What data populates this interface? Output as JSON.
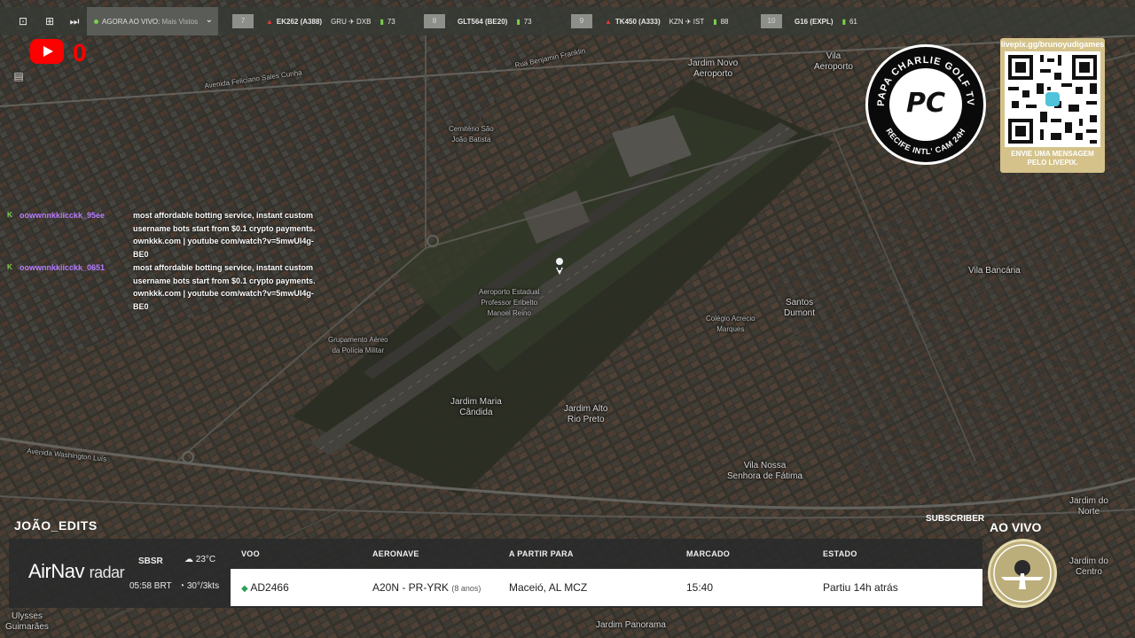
{
  "topbar": {
    "live_label": "AGORA AO VIVO:",
    "live_more": "Mais Vistos",
    "flights": [
      {
        "num": "7",
        "code": "EK262 (A388)",
        "route": "GRU ✈ DXB",
        "signal": "73",
        "alert": true
      },
      {
        "num": "8",
        "code": "GLT564 (BE20)",
        "route": "",
        "signal": "73",
        "alert": false
      },
      {
        "num": "9",
        "code": "TK450 (A333)",
        "route": "KZN ✈ IST",
        "signal": "88",
        "alert": true
      },
      {
        "num": "10",
        "code": "G16 (EXPL)",
        "route": "",
        "signal": "61",
        "alert": false
      }
    ]
  },
  "youtube": {
    "count": "0"
  },
  "chat": [
    {
      "user": "oowwnnkkiicckk_95ee",
      "message": "most affordable botting service, instant custom username bots start from $0.1 crypto payments. ownkkk.com | youtube com/watch?v=5mwUI4g-BE0"
    },
    {
      "user": "oowwnnkkiicckk_0651",
      "message": "most affordable botting service, instant custom username bots start from $0.1 crypto payments. ownkkk.com | youtube com/watch?v=5mwUI4g-BE0"
    }
  ],
  "map_labels": [
    {
      "text": "Jardim Novo\nAeroporto"
    },
    {
      "text": "Vila\nAeroporto"
    },
    {
      "text": "Cemitério São\nJoão Batista"
    },
    {
      "text": "Aeroporto Estadual\nProfessor Eribelto\nManoel Reino"
    },
    {
      "text": "Jardim Maria\nCândida"
    },
    {
      "text": "Jardim Alto\nRio Preto"
    },
    {
      "text": "Santos\nDumont"
    },
    {
      "text": "Vila Bancária"
    },
    {
      "text": "Vila Nossa\nSenhora de Fátima"
    },
    {
      "text": "Grupamento Aéreo\nda Polícia Militar"
    },
    {
      "text": "Jardim do\nNorte"
    },
    {
      "text": "Jardim do\nCentro"
    },
    {
      "text": "Jardim Panorama"
    },
    {
      "text": "Ulysses\nGuimarães"
    },
    {
      "text": "Colégio Acrecio\nMarques"
    },
    {
      "text": "Avenida Feliciano Sales Cunha"
    },
    {
      "text": "Rua Benjamin Franklin"
    },
    {
      "text": "Avenida Washington Luís"
    }
  ],
  "logos": {
    "pcg_top": "PAPA CHARLIE GOLF TV",
    "pcg_bottom": "RECIFE INTL' CAM 24H",
    "pcg_mark": "PC",
    "qr_url": "livepix.gg/brunoyudigames",
    "qr_caption": "ENVIE UMA MENSAGEM\nPELO LIVEPIX."
  },
  "bottom": {
    "streamer": "JOÃO_EDITS",
    "subscriber": "SUBSCRIBER",
    "live": "AO VIVO",
    "brand": "AirNav",
    "brand_sub": "radar",
    "airport": "SBSR",
    "time": "05:58 BRT",
    "temp": "23°C",
    "wind": "30°/3kts",
    "headers": {
      "flight": "VOO",
      "aircraft": "AERONAVE",
      "route": "A PARTIR PARA",
      "scheduled": "MARCADO",
      "status": "ESTADO"
    },
    "row": {
      "flight": "AD2466",
      "aircraft": "A20N - PR-YRK",
      "age": "(8 anos)",
      "route": "Maceió, AL MCZ",
      "scheduled": "15:40",
      "status": "Partiu 14h atrás"
    }
  }
}
